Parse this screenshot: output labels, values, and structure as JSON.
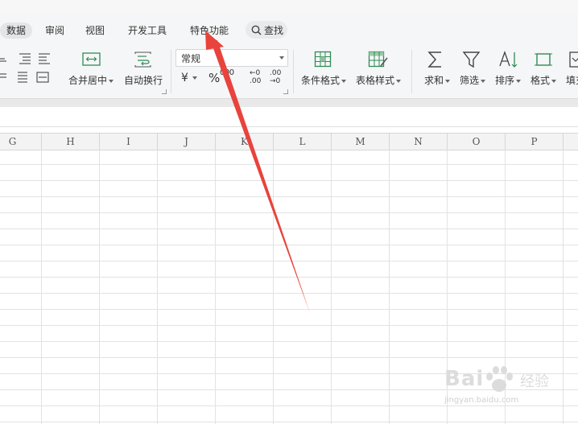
{
  "tabs": [
    {
      "label": "数据",
      "active": true
    },
    {
      "label": "审阅"
    },
    {
      "label": "视图"
    },
    {
      "label": "开发工具"
    },
    {
      "label": "特色功能"
    }
  ],
  "search": {
    "label": "查找"
  },
  "ribbon": {
    "merge_center": "合并居中",
    "wrap_text": "自动换行",
    "number_format": "常规",
    "currency_symbol": "¥",
    "percent_symbol": "%",
    "thousands": "000",
    "inc_decimal": "←0 .00",
    "dec_decimal": ".00 →0",
    "conditional_format": "条件格式",
    "table_style": "表格样式",
    "sum": "求和",
    "filter": "筛选",
    "sort": "排序",
    "format": "格式",
    "fill": "填充"
  },
  "columns": [
    "G",
    "H",
    "I",
    "J",
    "K",
    "L",
    "M",
    "N",
    "O",
    "P"
  ],
  "annotation": {
    "color": "#e8433c"
  },
  "watermark": {
    "brand": "Bai",
    "brand_cn": "经验",
    "url": "jingyan.baidu.com"
  },
  "colors": {
    "ribbon_bg": "#f5f6f7",
    "grid_line": "#e2e2e2",
    "header_bg": "#f3f3f3"
  }
}
